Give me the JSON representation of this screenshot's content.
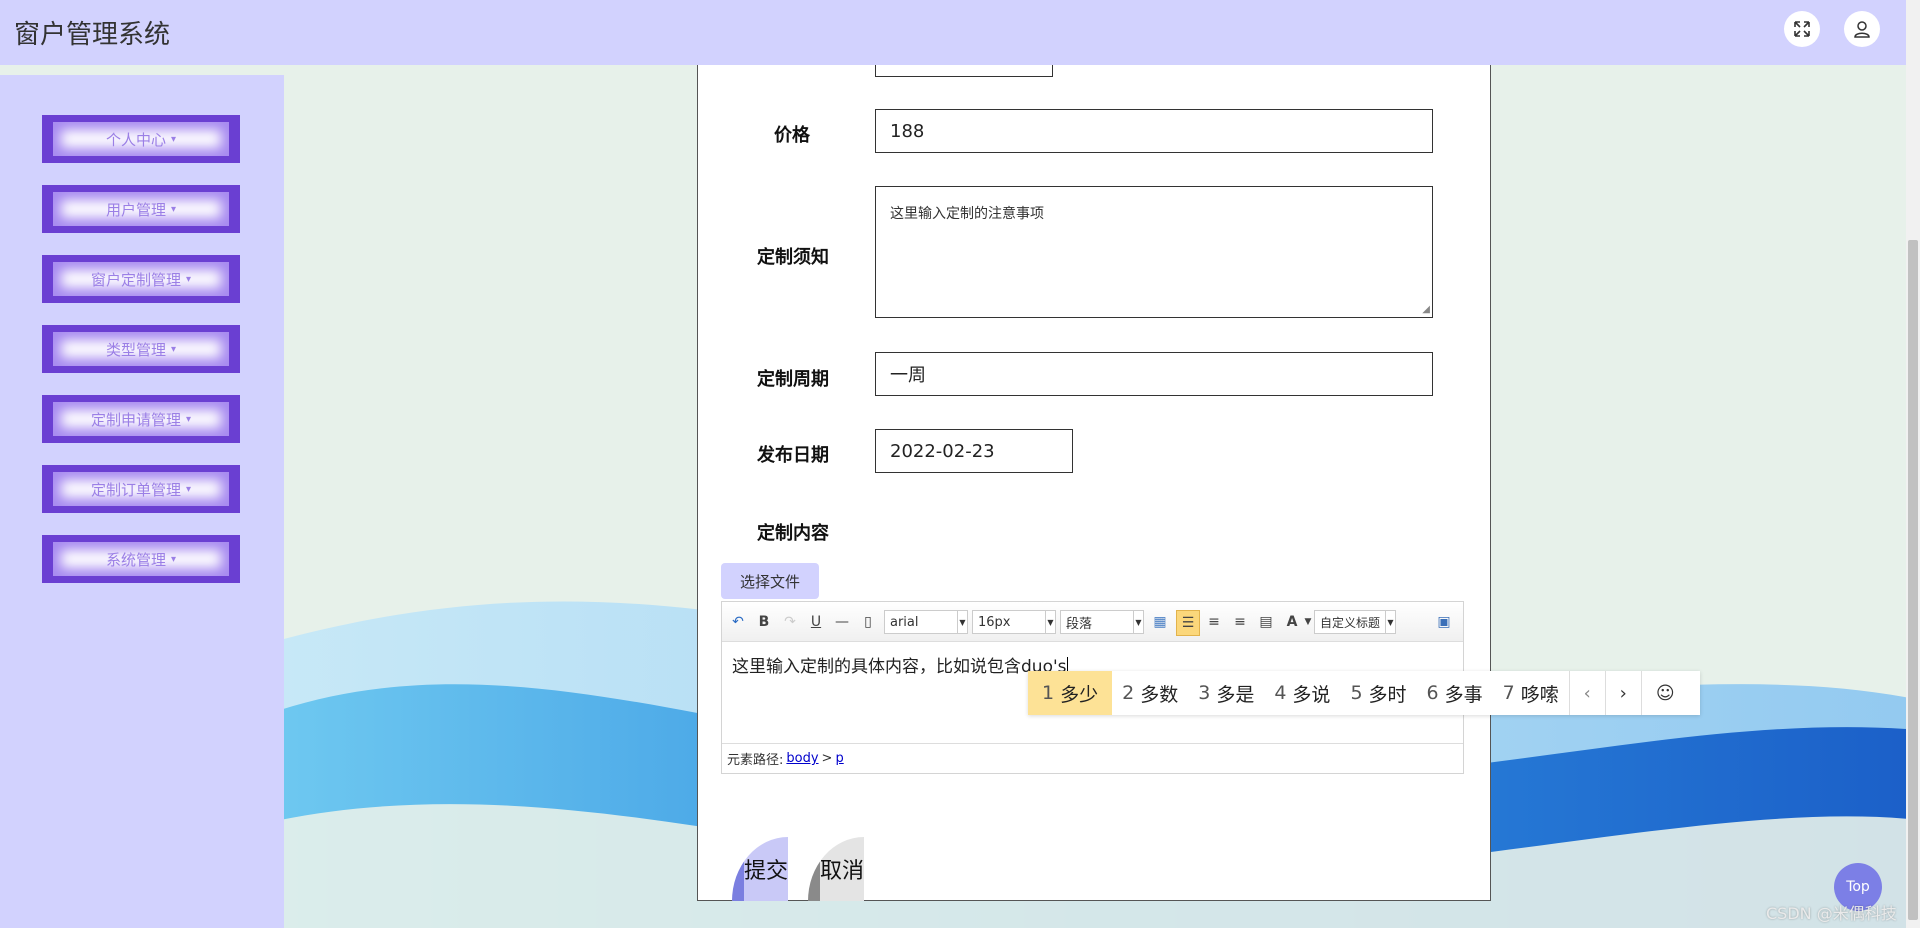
{
  "header": {
    "title": "窗户管理系统",
    "fullscreen_icon": "expand-icon",
    "user_icon": "user-icon"
  },
  "sidebar": {
    "items": [
      {
        "label": "个人中心"
      },
      {
        "label": "用户管理"
      },
      {
        "label": "窗户定制管理"
      },
      {
        "label": "类型管理"
      },
      {
        "label": "定制申请管理"
      },
      {
        "label": "定制订单管理"
      },
      {
        "label": "系统管理"
      }
    ],
    "caret": "▾"
  },
  "form": {
    "price_label": "价格",
    "price_value": "188",
    "notice_label": "定制须知",
    "notice_value": "这里输入定制的注意事项",
    "period_label": "定制周期",
    "period_value": "一周",
    "date_label": "发布日期",
    "date_value": "2022-02-23",
    "content_label": "定制内容",
    "file_button": "选择文件"
  },
  "editor": {
    "font_family": "arial",
    "font_size": "16px",
    "paragraph": "段落",
    "custom_title": "自定义标题",
    "content": "这里输入定制的具体内容，比如说包含duo's",
    "path_label": "元素路径:",
    "path_body": "body",
    "path_sep": ">",
    "path_p": "p",
    "bold_glyph": "B",
    "underline_glyph": "U",
    "font_color_glyph": "A"
  },
  "ime": {
    "candidates": [
      {
        "num": "1",
        "text": "多少"
      },
      {
        "num": "2",
        "text": "多数"
      },
      {
        "num": "3",
        "text": "多是"
      },
      {
        "num": "4",
        "text": "多说"
      },
      {
        "num": "5",
        "text": "多时"
      },
      {
        "num": "6",
        "text": "多事"
      },
      {
        "num": "7",
        "text": "哆嗦"
      }
    ],
    "prev": "‹",
    "next": "›",
    "emoji": "☺"
  },
  "actions": {
    "submit": "提交",
    "cancel": "取消"
  },
  "top_button": "Top",
  "watermark": "CSDN @米偶科技",
  "colors": {
    "header_bg": "#d2d2fe",
    "sidebar_item": "#6a3fd2",
    "ime_selected": "#fde296",
    "top_button": "#7c7fe6"
  }
}
